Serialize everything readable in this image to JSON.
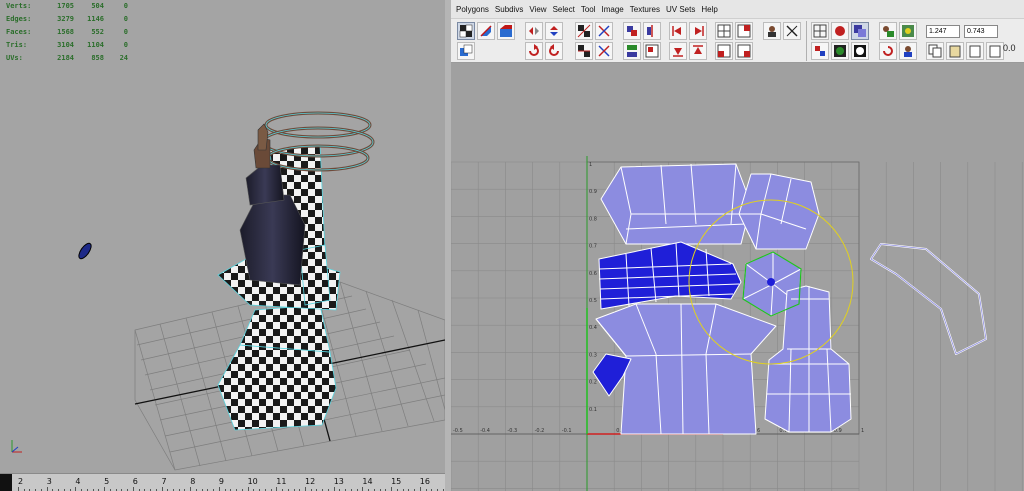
{
  "hud": {
    "rows": [
      {
        "label": "Verts:",
        "v1": "1705",
        "v2": "504",
        "v3": "0"
      },
      {
        "label": "Edges:",
        "v1": "3279",
        "v2": "1146",
        "v3": "0"
      },
      {
        "label": "Faces:",
        "v1": "1568",
        "v2": "552",
        "v3": "0"
      },
      {
        "label": "Tris:",
        "v1": "3104",
        "v2": "1104",
        "v3": "0"
      },
      {
        "label": "UVs:",
        "v1": "2184",
        "v2": "858",
        "v3": "24"
      }
    ]
  },
  "timeline": {
    "ticks": [
      "2",
      "3",
      "4",
      "5",
      "6",
      "7",
      "8",
      "9",
      "10",
      "11",
      "12",
      "13",
      "14",
      "15",
      "16"
    ]
  },
  "uv_editor": {
    "menu": [
      "Polygons",
      "Subdivs",
      "View",
      "Select",
      "Tool",
      "Image",
      "Textures",
      "UV Sets",
      "Help"
    ],
    "u_value": "1.247",
    "v_value": "0.743",
    "readout": "0.0",
    "grid_labels_top": [
      "1",
      "0.9",
      "0.8",
      "0.7",
      "0.6",
      "0.5",
      "0.4",
      "0.3",
      "0.2",
      "0.1"
    ],
    "grid_labels_left": [
      "-0.5",
      "-0.4",
      "-0.3",
      "-0.2",
      "-0.1"
    ],
    "grid_labels_bottom": [
      "0.1",
      "0.2",
      "0.3",
      "0.4",
      "0.5",
      "0.6",
      "0.7",
      "0.8",
      "0.9",
      "1"
    ]
  },
  "colors": {
    "uv_shell": "#8c8ce0",
    "uv_selected": "#1f1fd8",
    "grid_line": "#8a8a8a",
    "manipulator": "#e0d020",
    "hud_text": "#2b6e2b"
  },
  "icons": {
    "menubar": [
      "polygons-menu"
    ],
    "toolbar": [
      "uv-move-icon",
      "uv-rotate-icon",
      "uv-scale-icon",
      "flip-u-icon",
      "flip-v-icon",
      "rotate-ccw-icon",
      "rotate-cw-icon",
      "checker-icon",
      "grid-icon",
      "snap-icon",
      "layout-icon",
      "unfold-icon",
      "align-icon",
      "copy-uv-icon",
      "paste-uv-icon"
    ]
  }
}
